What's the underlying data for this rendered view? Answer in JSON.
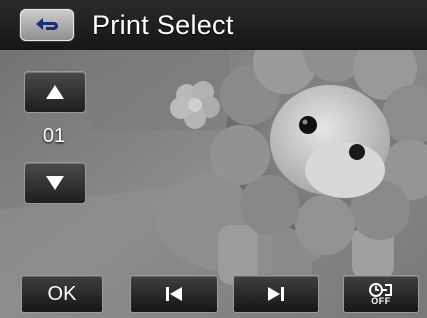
{
  "header": {
    "title": "Print Select",
    "back_icon": "return-arrow-icon"
  },
  "selector": {
    "up_icon": "triangle-up-icon",
    "count": "01",
    "down_icon": "triangle-down-icon"
  },
  "toolbar": {
    "ok_label": "OK",
    "prev_icon": "skip-previous-icon",
    "next_icon": "skip-next-icon",
    "timer_icon": "timer-icon",
    "timer_state": "OFF"
  },
  "colors": {
    "title_bar": "#1e1e1e",
    "button_face": "#2a2a2a",
    "button_border": "#9c9c9c",
    "text": "#ffffff"
  }
}
